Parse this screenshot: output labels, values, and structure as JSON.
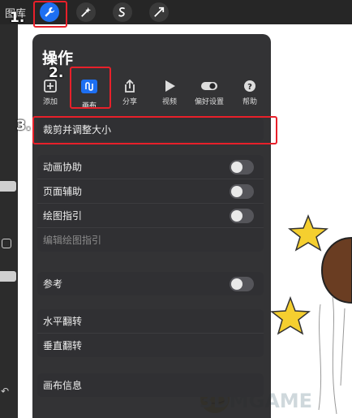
{
  "toolbar": {
    "gallery_label": "图库",
    "tools": [
      {
        "icon": "wrench-icon",
        "active": true
      },
      {
        "icon": "magic-wand-icon",
        "active": false
      },
      {
        "icon": "selection-icon",
        "active": false
      },
      {
        "icon": "transform-arrow-icon",
        "active": false
      }
    ]
  },
  "annotations": {
    "step1": "1.",
    "step2": "2.",
    "step3": "3.",
    "box_color": "#e8202a"
  },
  "panel": {
    "title": "操作",
    "tabs": [
      {
        "label": "添加",
        "icon": "add-image-icon"
      },
      {
        "label": "画布",
        "icon": "canvas-icon",
        "active": true
      },
      {
        "label": "分享",
        "icon": "share-icon"
      },
      {
        "label": "视频",
        "icon": "play-icon"
      },
      {
        "label": "偏好设置",
        "icon": "toggle-icon"
      },
      {
        "label": "帮助",
        "icon": "help-icon"
      }
    ],
    "crop_row": "裁剪并调整大小",
    "rows_group1": [
      {
        "label": "动画协助",
        "toggle": false
      },
      {
        "label": "页面辅助",
        "toggle": false
      },
      {
        "label": "绘图指引",
        "toggle": false
      },
      {
        "label": "编辑绘图指引",
        "disabled": true
      }
    ],
    "rows_group2": [
      {
        "label": "参考",
        "toggle": false
      }
    ],
    "rows_group3": [
      {
        "label": "水平翻转"
      },
      {
        "label": "垂直翻转"
      }
    ],
    "rows_group4": [
      {
        "label": "画布信息"
      }
    ]
  },
  "watermark": "3DMGAME",
  "colors": {
    "accent": "#1d6ff2",
    "panel_bg": "#262628",
    "star": "#f5cf2f",
    "annotation": "#e8202a"
  }
}
